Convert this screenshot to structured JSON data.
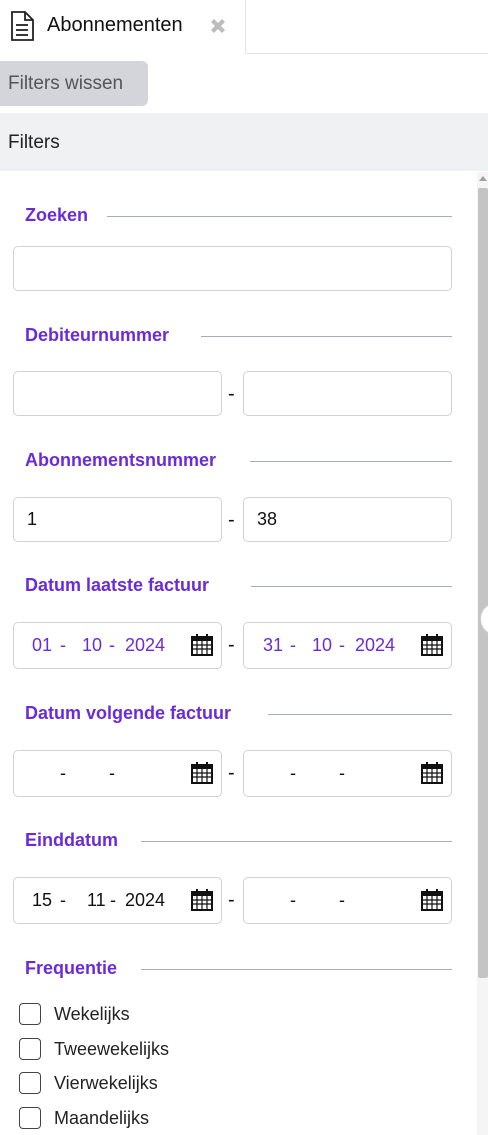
{
  "tab": {
    "label": "Abonnementen",
    "icon": "document-icon",
    "close_icon": "close-icon"
  },
  "toolbar": {
    "clear_filters_label": "Filters wissen"
  },
  "filters": {
    "title": "Filters",
    "search": {
      "title": "Zoeken",
      "value": ""
    },
    "debtor_number": {
      "title": "Debiteurnummer",
      "from": "",
      "to": "",
      "separator": "-"
    },
    "subscription_number": {
      "title": "Abonnementsnummer",
      "from": "1",
      "to": "38",
      "separator": "-"
    },
    "last_invoice_date": {
      "title": "Datum laatste factuur",
      "from": {
        "day": "01",
        "month": "10",
        "year": "2024"
      },
      "to": {
        "day": "31",
        "month": "10",
        "year": "2024"
      },
      "separator": "-"
    },
    "next_invoice_date": {
      "title": "Datum volgende factuur",
      "from": {
        "day": "",
        "month": "",
        "year": ""
      },
      "to": {
        "day": "",
        "month": "",
        "year": ""
      },
      "separator": "-"
    },
    "end_date": {
      "title": "Einddatum",
      "from": {
        "day": "15",
        "month": "11",
        "year": "2024"
      },
      "to": {
        "day": "",
        "month": "",
        "year": ""
      },
      "separator": "-"
    },
    "frequency": {
      "title": "Frequentie",
      "options": [
        {
          "label": "Wekelijks",
          "checked": false
        },
        {
          "label": "Tweewekelijks",
          "checked": false
        },
        {
          "label": "Vierwekelijks",
          "checked": false
        },
        {
          "label": "Maandelijks",
          "checked": false
        }
      ]
    }
  },
  "colors": {
    "accent": "#6c2bd9",
    "panel_bg": "#f0f1f3",
    "button_bg": "#d3d5da"
  }
}
